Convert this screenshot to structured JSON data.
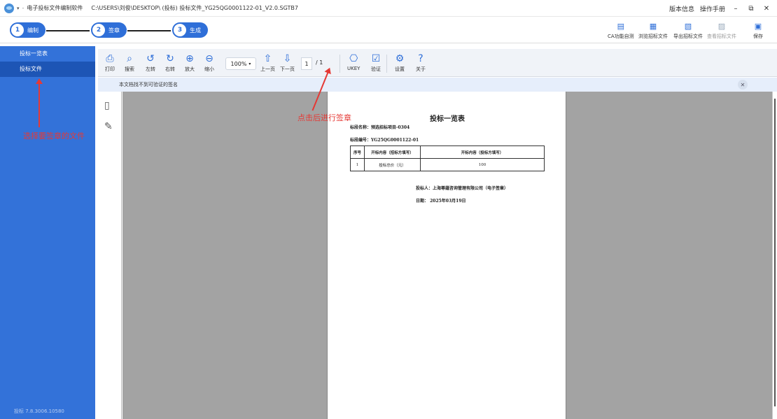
{
  "titlebar": {
    "app_name": "电子投标文件编制软件",
    "path": "C:\\USERS\\刘俊\\DESKTOP\\ (投标) 投标文件_YG25QG0001122-01_V2.0.SGTB7",
    "version_info": "版本信息",
    "manual": "操作手册"
  },
  "steps": [
    {
      "num": "1",
      "label": "编制"
    },
    {
      "num": "2",
      "label": "签章"
    },
    {
      "num": "3",
      "label": "生成"
    }
  ],
  "top_tools": [
    {
      "label": "CA功能自测",
      "icon": "document-check-icon",
      "enabled": true
    },
    {
      "label": "浏览招标文件",
      "icon": "document-view-icon",
      "enabled": true
    },
    {
      "label": "导出招标文件",
      "icon": "document-export-icon",
      "enabled": true
    },
    {
      "label": "查看招标文件",
      "icon": "document-search-icon",
      "enabled": false
    },
    {
      "label": "保存",
      "icon": "save-icon",
      "enabled": true
    }
  ],
  "sidebar": {
    "items": [
      {
        "label": "投标一览表",
        "selected": false
      },
      {
        "label": "投标文件",
        "selected": true
      }
    ],
    "version": "投标  7.8.3006.10580",
    "annotation": "选择要签章的文件"
  },
  "toolbar": {
    "print": "打印",
    "search": "搜索",
    "rotate_left": "左转",
    "rotate_right": "右转",
    "zoom_in": "放大",
    "zoom_out": "缩小",
    "zoom_level": "100%",
    "prev_page": "上一页",
    "next_page": "下一页",
    "current_page": "1",
    "total_pages": "/  1",
    "ukey": "UKEY",
    "verify": "验证",
    "settings": "设置",
    "about": "关于"
  },
  "infobar": {
    "message": "本文档找不到可验证的签名"
  },
  "annotation_sign": "点击后进行签章",
  "document": {
    "title": "投标一览表",
    "section_name": "标段名称：预选招标项目-0304",
    "section_code": "标段编号：YG25QG0001122-01",
    "table_headers": [
      "序号",
      "开标内容（招标方填写）",
      "开标内容（投标方填写）"
    ],
    "table_rows": [
      [
        "1",
        "投标总价（元）",
        "100"
      ]
    ],
    "bidder": "投标人：上海尊蕴咨询管理有限公司（电子签章）",
    "date": "日期：  2025年03月19日"
  },
  "colors": {
    "accent": "#2f6fd8",
    "sidebar": "#3372d9",
    "annotation": "#e53935"
  }
}
